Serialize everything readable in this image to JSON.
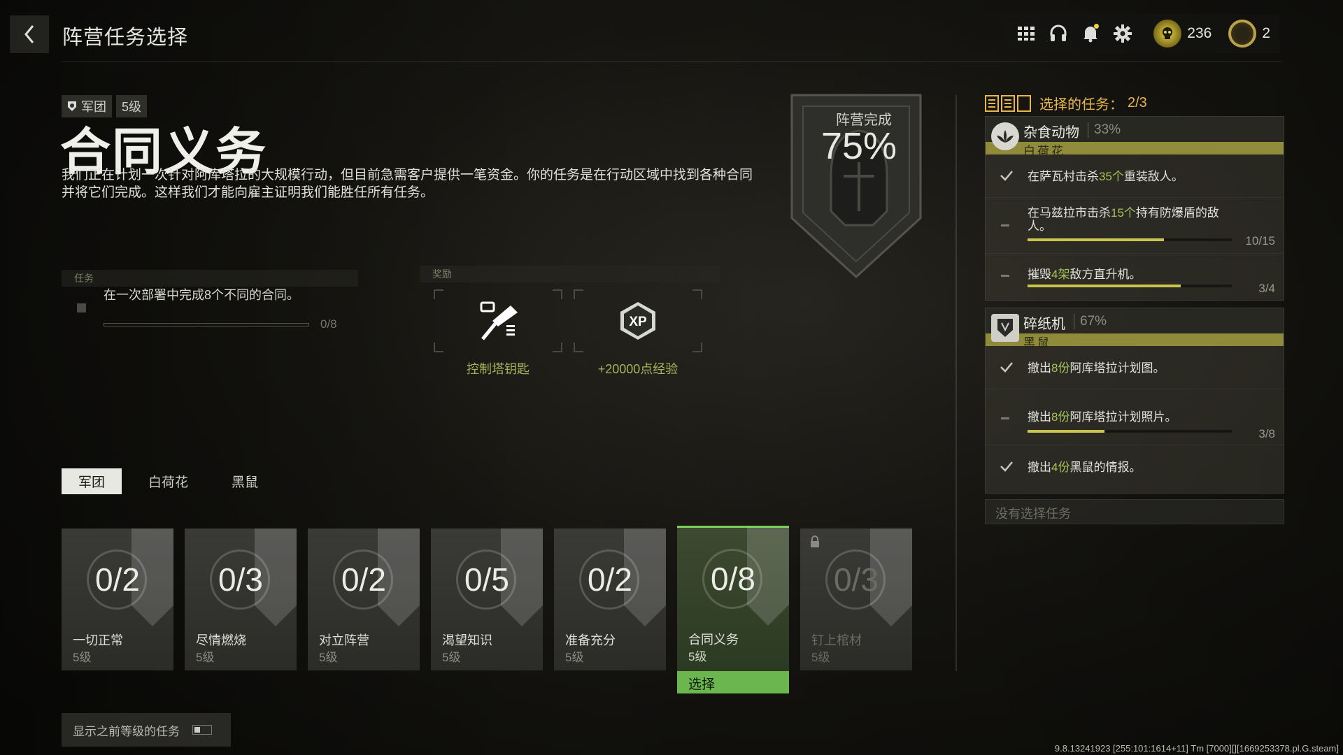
{
  "header": {
    "title": "阵营任务选择",
    "currency1_value": "236",
    "currency2_value": "2"
  },
  "mission": {
    "tag_faction": "军团",
    "tag_level": "5级",
    "title": "合同义务",
    "description": "我们正在计划一次针对阿库塔拉的大规模行动，但目前急需客户提供一笔资金。你的任务是在行动区域中找到各种合同并将它们完成。这样我们才能向雇主证明我们能胜任所有任务。"
  },
  "faction_completion": {
    "label": "阵营完成",
    "percent": "75%"
  },
  "task_section": {
    "label": "任务",
    "task_text": "在一次部署中完成8个不同的合同。",
    "task_count": "0/8",
    "progress": 0
  },
  "reward_section": {
    "label": "奖励",
    "rewards": [
      {
        "name": "控制塔钥匙",
        "icon": "key-icon"
      },
      {
        "name": "+20000点经验",
        "icon": "xp-icon",
        "icon_text": "XP"
      }
    ]
  },
  "filter_tabs": [
    "军团",
    "白荷花",
    "黑鼠"
  ],
  "cards": [
    {
      "count": "0/2",
      "name": "一切正常",
      "level": "5级"
    },
    {
      "count": "0/3",
      "name": "尽情燃烧",
      "level": "5级"
    },
    {
      "count": "0/2",
      "name": "对立阵营",
      "level": "5级"
    },
    {
      "count": "0/5",
      "name": "渴望知识",
      "level": "5级"
    },
    {
      "count": "0/2",
      "name": "准备充分",
      "level": "5级"
    },
    {
      "count": "0/8",
      "name": "合同义务",
      "level": "5级"
    },
    {
      "count": "0/3",
      "name": "钉上棺材",
      "level": "5级"
    }
  ],
  "select_label": "选择",
  "toggle_label": "显示之前等级的任务",
  "selected_tasks": {
    "header_prefix": "选择的任务：",
    "header_count": "2/3",
    "panels": [
      {
        "name": "杂食动物",
        "percent": "33%",
        "faction": "白荷花",
        "objectives": [
          {
            "done": true,
            "pre": "在萨瓦村击杀",
            "em": "35个",
            "post": "重装敌人。",
            "count": "",
            "progress": 1
          },
          {
            "done": false,
            "pre": "在马兹拉市击杀",
            "em": "15个",
            "post": "持有防爆盾的敌人。",
            "count": "10/15",
            "progress": 0.6667
          },
          {
            "done": false,
            "pre": "摧毁",
            "em": "4架",
            "post": "敌方直升机。",
            "count": "3/4",
            "progress": 0.75
          }
        ]
      },
      {
        "name": "碎纸机",
        "percent": "67%",
        "faction": "黑鼠",
        "objectives": [
          {
            "done": true,
            "pre": "撤出",
            "em": "8份",
            "post": "阿库塔拉计划图。",
            "count": "",
            "progress": 1
          },
          {
            "done": false,
            "pre": "撤出",
            "em": "8份",
            "post": "阿库塔拉计划照片。",
            "count": "3/8",
            "progress": 0.375
          },
          {
            "done": true,
            "pre": "撤出",
            "em": "4份",
            "post": "黑鼠的情报。",
            "count": "",
            "progress": 1
          }
        ]
      }
    ],
    "empty_slot": "没有选择任务"
  },
  "footer": {
    "build_info": "9.8.13241923 [255:101:1614+11] Tm [7000][][1669253378.pl.G.steam]"
  },
  "colors": {
    "accent_green": "#6bb64e",
    "accent_gold": "#e8b64a",
    "faction_bar": "#8f8b3a",
    "reward_text": "#a6b35a"
  }
}
